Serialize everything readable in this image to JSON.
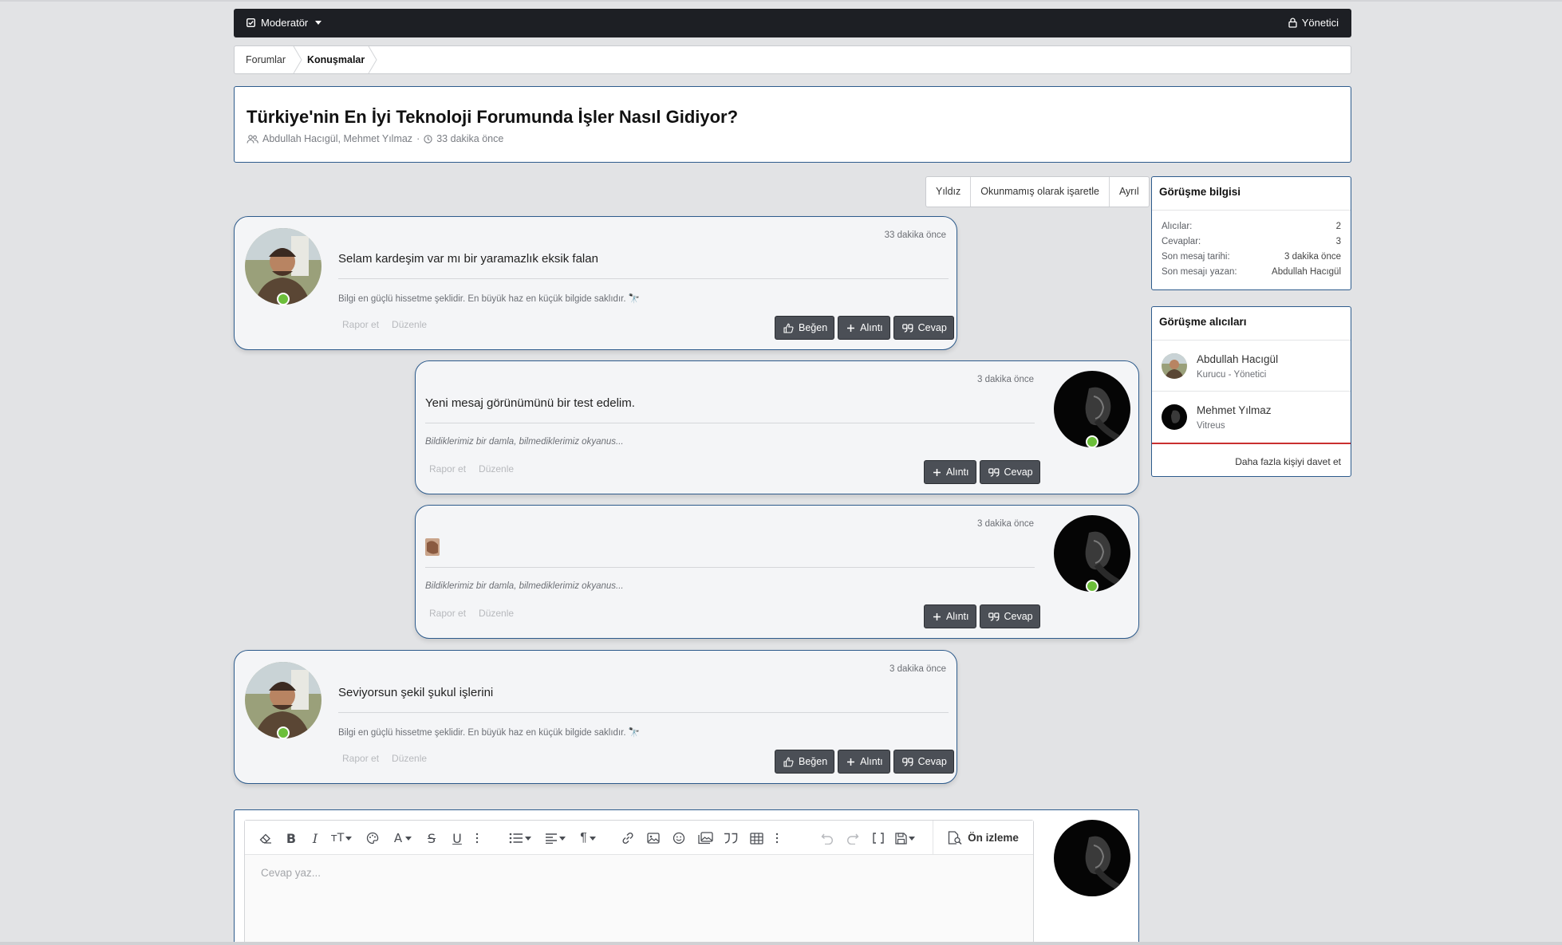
{
  "topbar": {
    "moderator_label": "Moderatör",
    "admin_label": "Yönetici"
  },
  "breadcrumb": [
    {
      "label": "Forumlar"
    },
    {
      "label": "Konuşmalar"
    }
  ],
  "thread": {
    "title": "Türkiye'nin En İyi Teknoloji Forumunda İşler Nasıl Gidiyor?",
    "participants": "Abdullah Hacıgül, Mehmet Yılmaz",
    "time": "33 dakika önce"
  },
  "actions": [
    "Yıldız",
    "Okunmamış olarak işaretle",
    "Ayrıl"
  ],
  "messages": [
    {
      "time": "33 dakika önce",
      "text": "Selam kardeşim var mı bir yaramazlık eksik falan",
      "signature": "Bilgi en güçlü hissetme şeklidir. En büyük haz en küçük bilgide saklıdır. 🔭",
      "links": [
        "Rapor et",
        "Düzenle"
      ],
      "buttons": [
        "Beğen",
        "Alıntı",
        "Cevap"
      ]
    },
    {
      "time": "3 dakika önce",
      "text": "Yeni mesaj görünümünü bir test edelim.",
      "signature": "Bildiklerimiz bir damla, bilmediklerimiz okyanus...",
      "links": [
        "Rapor et",
        "Düzenle"
      ],
      "buttons": [
        "Alıntı",
        "Cevap"
      ]
    },
    {
      "time": "3 dakika önce",
      "text": "",
      "signature": "Bildiklerimiz bir damla, bilmediklerimiz okyanus...",
      "links": [
        "Rapor et",
        "Düzenle"
      ],
      "buttons": [
        "Alıntı",
        "Cevap"
      ]
    },
    {
      "time": "3 dakika önce",
      "text": "Seviyorsun şekil şukul işlerini",
      "signature": "Bilgi en güçlü hissetme şeklidir. En büyük haz en küçük bilgide saklıdır. 🔭",
      "links": [
        "Rapor et",
        "Düzenle"
      ],
      "buttons": [
        "Beğen",
        "Alıntı",
        "Cevap"
      ]
    }
  ],
  "sidebar": {
    "info_title": "Görüşme bilgisi",
    "info": [
      {
        "k": "Alıcılar:",
        "v": "2"
      },
      {
        "k": "Cevaplar:",
        "v": "3"
      },
      {
        "k": "Son mesaj tarihi:",
        "v": "3 dakika önce"
      },
      {
        "k": "Son mesajı yazan:",
        "v": "Abdullah Hacıgül"
      }
    ],
    "recipients_title": "Görüşme alıcıları",
    "recipients": [
      {
        "name": "Abdullah Hacıgül",
        "role": "Kurucu - Yönetici"
      },
      {
        "name": "Mehmet Yılmaz",
        "role": "Vitreus"
      }
    ],
    "invite_label": "Daha fazla kişiyi davet et"
  },
  "editor": {
    "placeholder": "Cevap yaz...",
    "preview_label": "Ön izleme"
  },
  "colors": {
    "border_accent": "#2d5b8c",
    "button_dark": "#4b4f56",
    "online": "#6cbf3a",
    "topbar": "#1d1f24"
  }
}
